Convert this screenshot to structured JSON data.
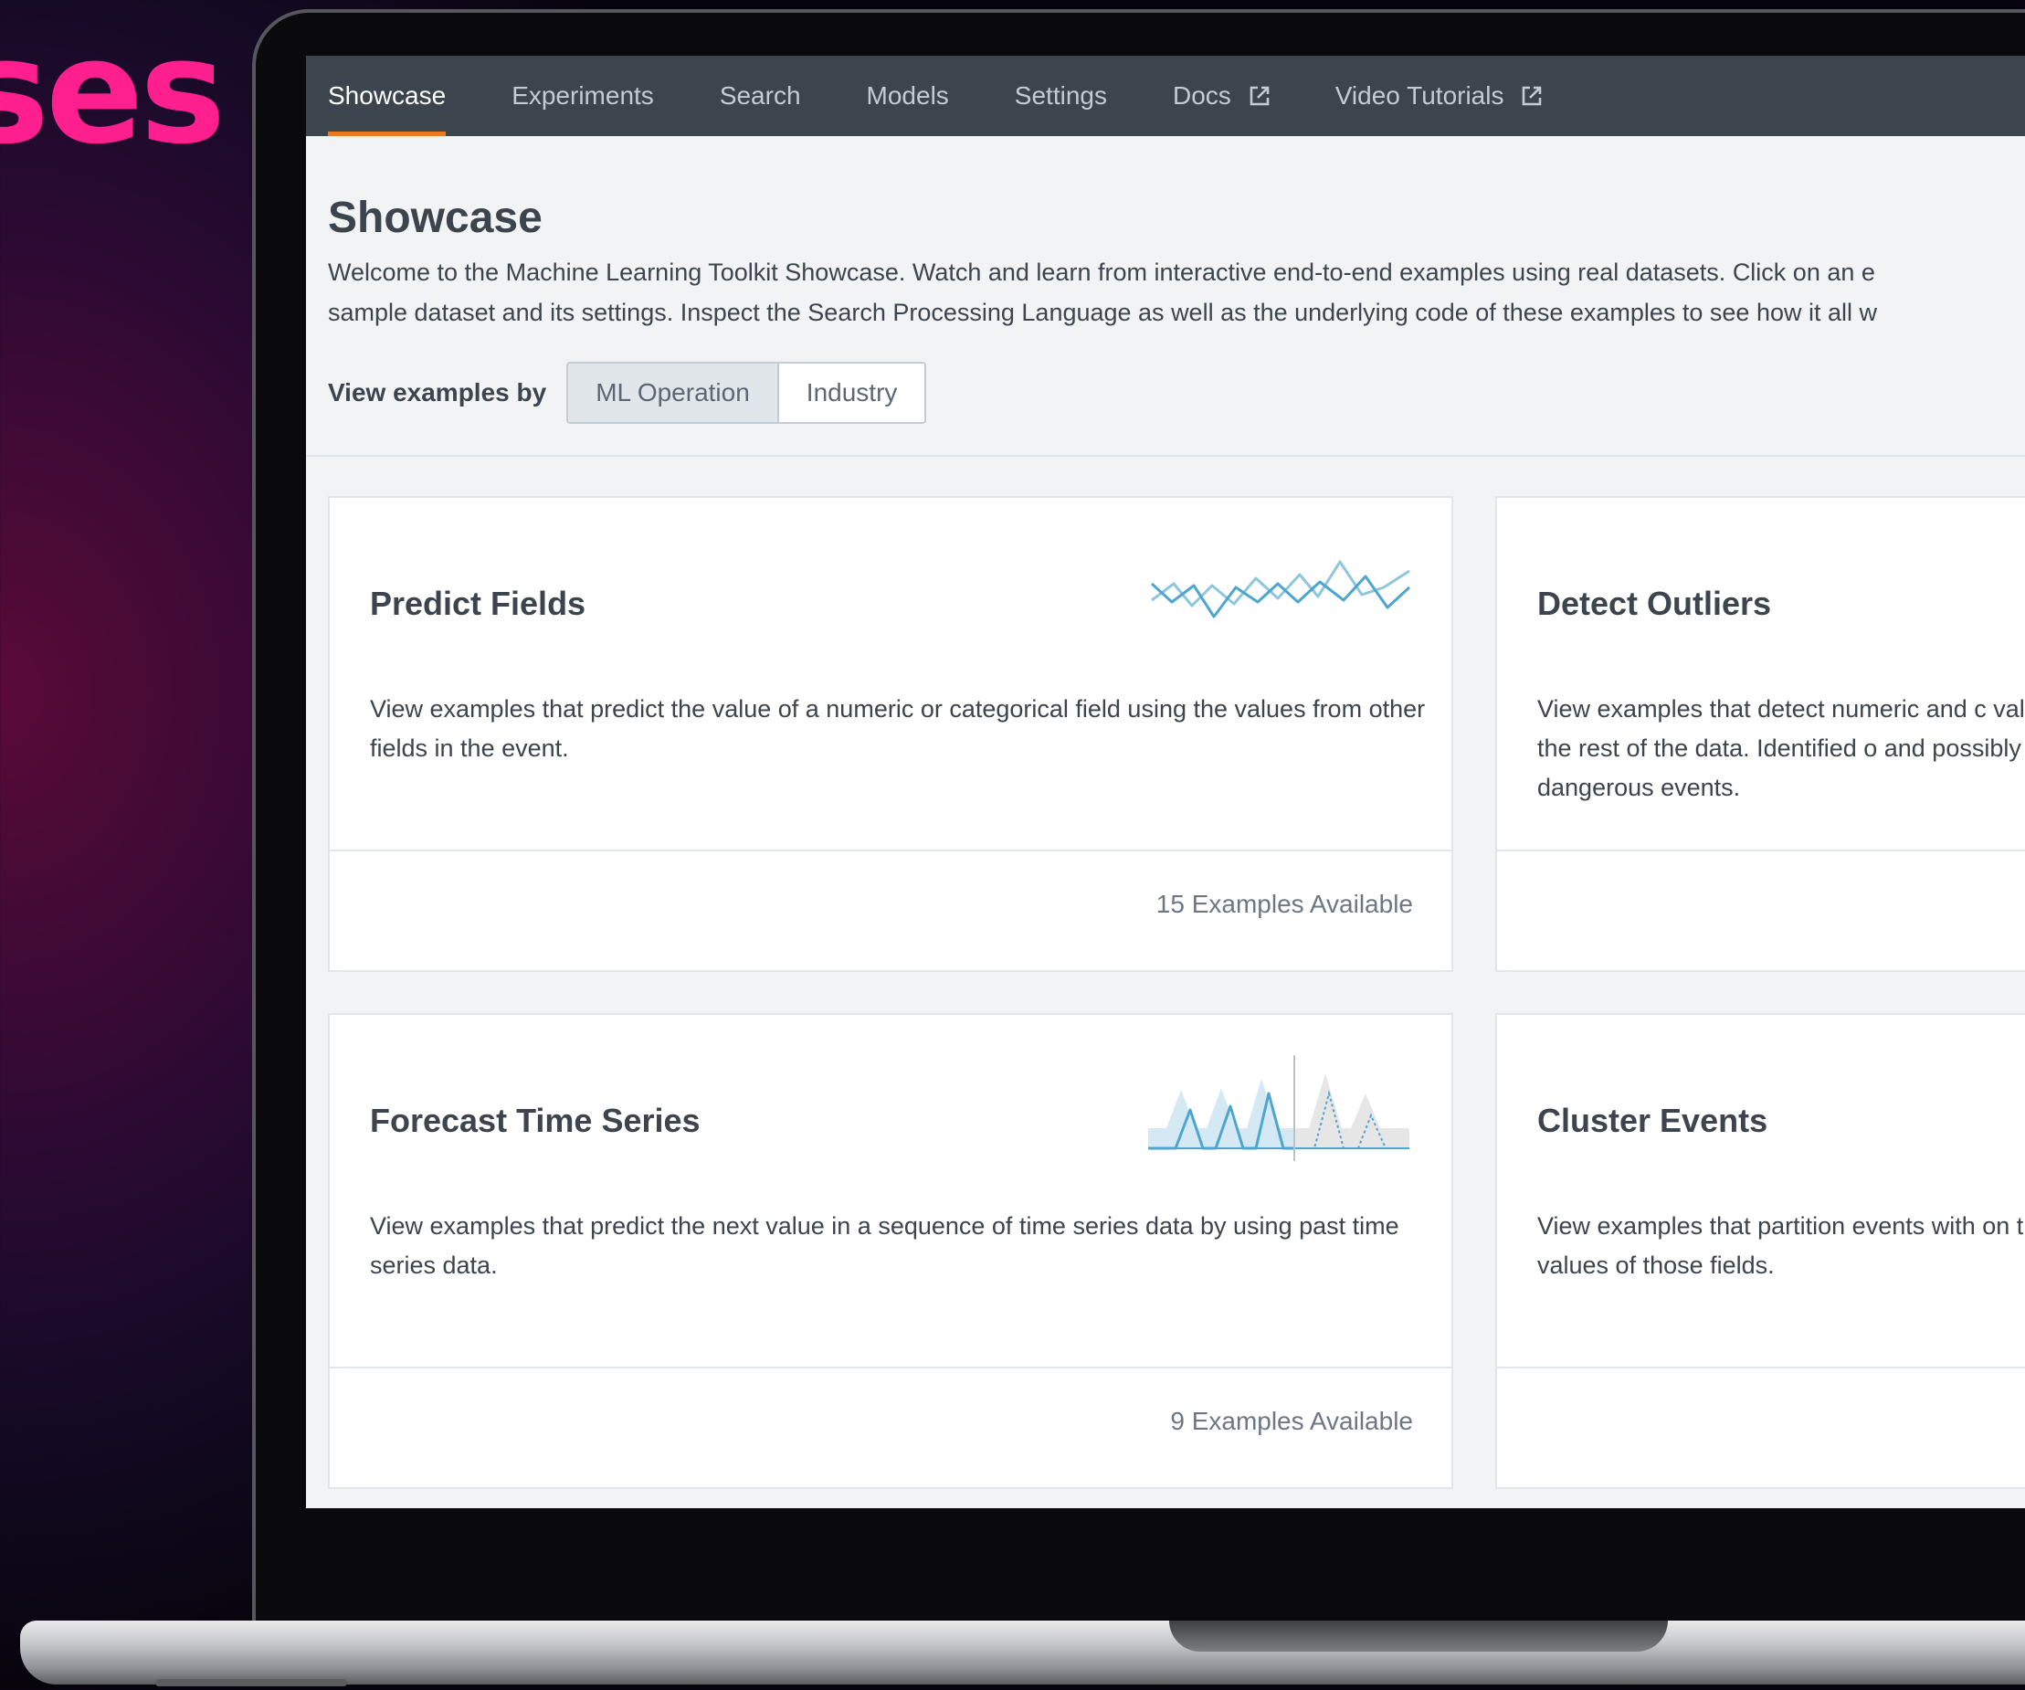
{
  "backdrop": {
    "word": "ses"
  },
  "nav": {
    "items": [
      {
        "label": "Showcase",
        "active": true
      },
      {
        "label": "Experiments"
      },
      {
        "label": "Search"
      },
      {
        "label": "Models"
      },
      {
        "label": "Settings"
      },
      {
        "label": "Docs",
        "icon": "external-link-icon"
      },
      {
        "label": "Video Tutorials",
        "icon": "external-link-icon"
      }
    ],
    "accent_color": "#ec7a1d",
    "background_color": "#3c444d"
  },
  "page": {
    "title": "Showcase",
    "description_line1": "Welcome to the Machine Learning Toolkit Showcase. Watch and learn from interactive end-to-end examples using real datasets. Click on an e",
    "description_line2": "sample dataset and its settings. Inspect the Search Processing Language as well as the underlying code of these examples to see how it all w"
  },
  "view_by": {
    "label": "View examples by",
    "options": [
      "ML Operation",
      "Industry"
    ],
    "selected": "ML Operation"
  },
  "cards": [
    {
      "title": "Predict Fields",
      "description": "View examples that predict the value of a numeric or categorical field using the values from other fields in the event.",
      "count_label": "15 Examples Available",
      "icon": "zigzag-lines-icon"
    },
    {
      "title": "Detect Outliers",
      "description": "View examples that detect numeric and c values in the rest of the data. Identified o and possibly dangerous events.",
      "count_label": "",
      "icon": ""
    },
    {
      "title": "Forecast Time Series",
      "description": "View examples that predict the next value in a sequence of time series data by using past time series data.",
      "count_label": "9 Examples Available",
      "icon": "forecast-peaks-icon"
    },
    {
      "title": "Cluster Events",
      "description": "View examples that partition events with on the values of those fields.",
      "count_label": "",
      "icon": ""
    }
  ]
}
